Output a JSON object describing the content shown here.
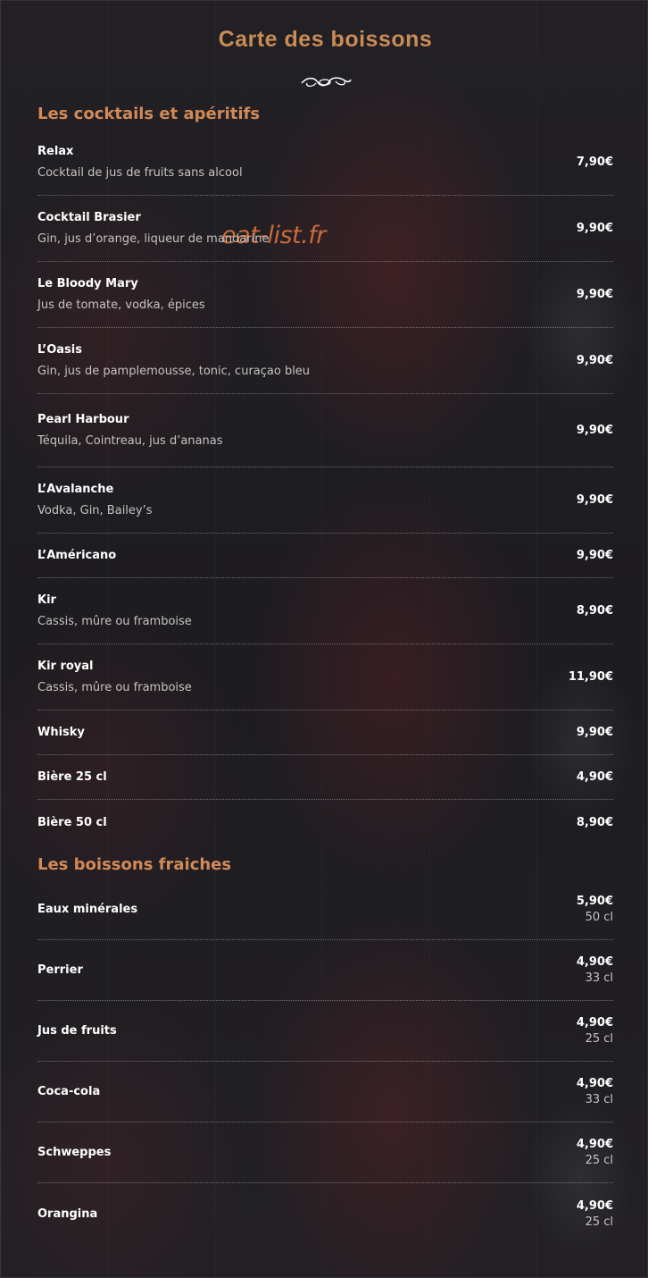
{
  "page": {
    "title": "Carte des boissons",
    "watermark": "eat-list.fr"
  },
  "sections": [
    {
      "title": "Les cocktails et apéritifs",
      "items": [
        {
          "name": "Relax",
          "desc": "Cocktail de jus de fruits sans alcool",
          "price": "7,90€"
        },
        {
          "name": "Cocktail Brasier",
          "desc": "Gin, jus d’orange, liqueur de mandarine",
          "price": "9,90€"
        },
        {
          "name": "Le Bloody Mary",
          "desc": "Jus de tomate, vodka, épices",
          "price": "9,90€"
        },
        {
          "name": "L’Oasis",
          "desc": "Gin, jus de pamplemousse, tonic, curaçao bleu",
          "price": "9,90€"
        },
        {
          "name": "Pearl Harbour",
          "desc": "Téquila, Cointreau, jus d’ananas",
          "price": "9,90€"
        },
        {
          "name": "L’Avalanche",
          "desc": "Vodka, Gin, Bailey’s",
          "price": "9,90€"
        },
        {
          "name": "L’Américano",
          "price": "9,90€"
        },
        {
          "name": "Kir",
          "desc": "Cassis, mûre ou framboise",
          "price": "8,90€"
        },
        {
          "name": "Kir royal",
          "desc": "Cassis, mûre ou framboise",
          "price": "11,90€"
        },
        {
          "name": "Whisky",
          "price": "9,90€"
        },
        {
          "name": "Bière 25 cl",
          "price": "4,90€"
        },
        {
          "name": "Bière 50 cl",
          "price": "8,90€"
        }
      ]
    },
    {
      "title": "Les boissons fraiches",
      "items": [
        {
          "name": "Eaux minérales",
          "price": "5,90€",
          "volume": "50 cl"
        },
        {
          "name": "Perrier",
          "price": "4,90€",
          "volume": "33 cl"
        },
        {
          "name": "Jus de fruits",
          "price": "4,90€",
          "volume": "25 cl"
        },
        {
          "name": "Coca-cola",
          "price": "4,90€",
          "volume": "33 cl"
        },
        {
          "name": "Schweppes",
          "price": "4,90€",
          "volume": "25 cl"
        },
        {
          "name": "Orangina",
          "price": "4,90€",
          "volume": "25 cl"
        }
      ]
    }
  ],
  "icons": {
    "ornament": "flourish-ornament-icon"
  },
  "colors": {
    "accent": "#d28a57",
    "background": "#1c1b1e",
    "text": "#ffffff",
    "muted": "#c7c3c0"
  }
}
